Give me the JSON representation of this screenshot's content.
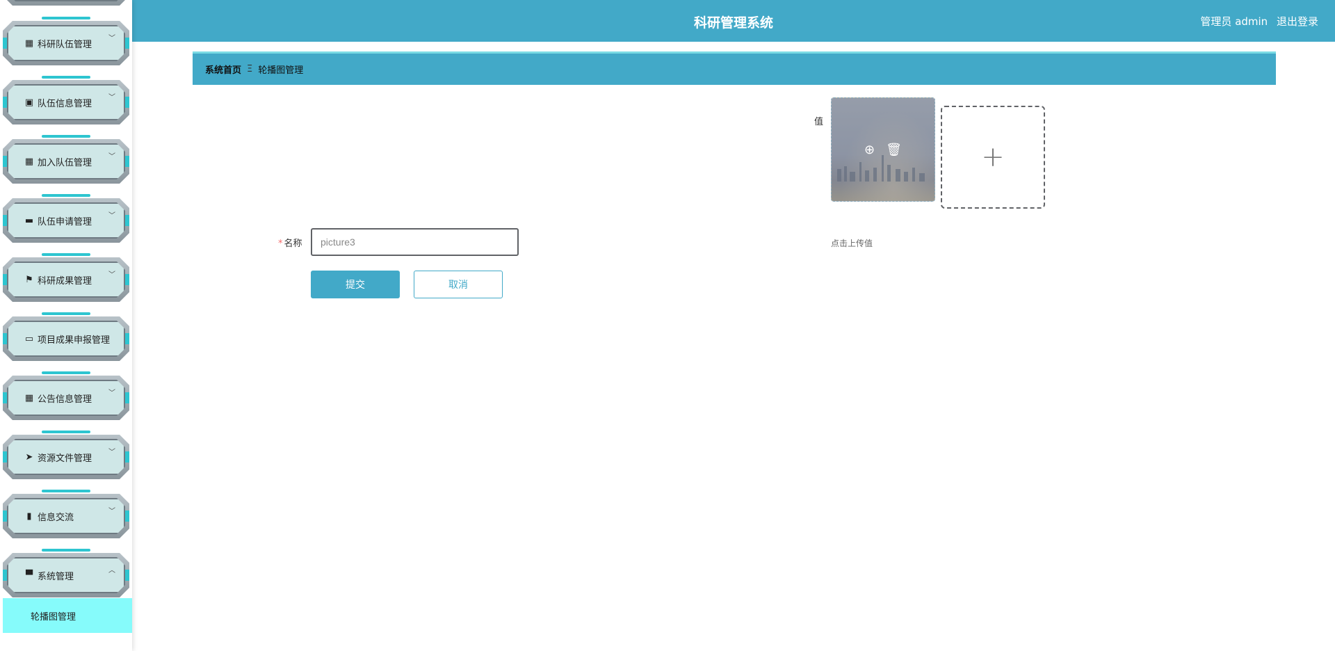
{
  "header": {
    "title": "科研管理系统",
    "user": "管理员 admin",
    "logout": "退出登录"
  },
  "breadcrumb": {
    "home": "系统首页",
    "separator": "Ξ",
    "current": "轮播图管理"
  },
  "sidebar": {
    "items": [
      {
        "label": "科研队伍管理",
        "icon": "grid-icon",
        "glyph": "▦",
        "chev": "﹀"
      },
      {
        "label": "队伍信息管理",
        "icon": "clipboard-icon",
        "glyph": "▣",
        "chev": "﹀"
      },
      {
        "label": "加入队伍管理",
        "icon": "grid-icon",
        "glyph": "▦",
        "chev": "﹀"
      },
      {
        "label": "队伍申请管理",
        "icon": "inbox-icon",
        "glyph": "▬",
        "chev": "﹀"
      },
      {
        "label": "科研成果管理",
        "icon": "flag-icon",
        "glyph": "⚑",
        "chev": "﹀"
      },
      {
        "label": "项目成果申报管理",
        "icon": "monitor-icon",
        "glyph": "▭",
        "chev": ""
      },
      {
        "label": "公告信息管理",
        "icon": "grid-icon",
        "glyph": "▦",
        "chev": "﹀"
      },
      {
        "label": "资源文件管理",
        "icon": "send-icon",
        "glyph": "➤",
        "chev": "﹀"
      },
      {
        "label": "信息交流",
        "icon": "book-icon",
        "glyph": "▮",
        "chev": "﹀"
      },
      {
        "label": "系统管理",
        "icon": "brush-icon",
        "glyph": "▀",
        "chev": "︿"
      }
    ],
    "active_sub": "轮播图管理"
  },
  "form": {
    "name_label": "名称",
    "name_value": "picture3",
    "value_label": "值",
    "upload_tip": "点击上传值",
    "submit": "提交",
    "cancel": "取消",
    "upload_plus": "+",
    "zoom_glyph": "⊕",
    "delete_glyph": "🗑"
  },
  "colors": {
    "primary": "#42a9c8",
    "accent": "#2ec5d0",
    "active_sub": "#86fbfb"
  }
}
